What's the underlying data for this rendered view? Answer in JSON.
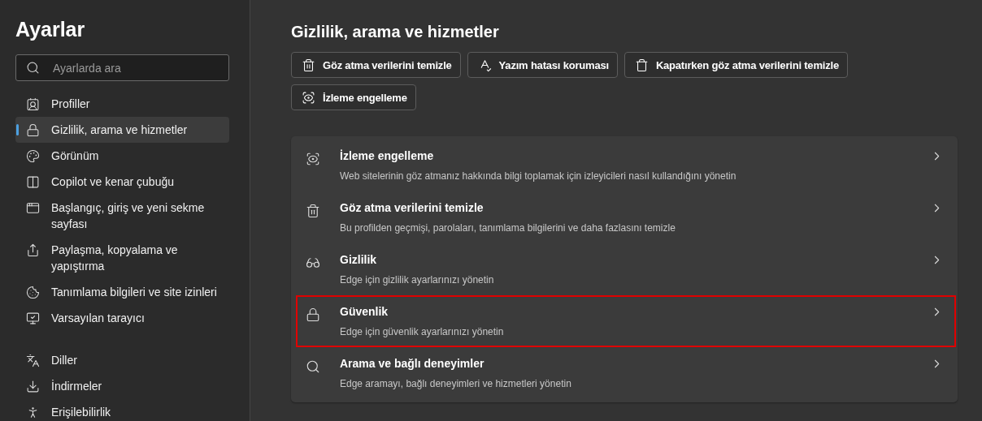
{
  "sidebar": {
    "title": "Ayarlar",
    "search": {
      "placeholder": "Ayarlarda ara"
    },
    "groups": [
      [
        {
          "label": "Profiller",
          "selected": false
        },
        {
          "label": "Gizlilik, arama ve hizmetler",
          "selected": true
        },
        {
          "label": "Görünüm",
          "selected": false
        },
        {
          "label": "Copilot ve kenar çubuğu",
          "selected": false
        },
        {
          "label": "Başlangıç, giriş ve yeni sekme sayfası",
          "selected": false
        },
        {
          "label": "Paylaşma, kopyalama ve yapıştırma",
          "selected": false
        },
        {
          "label": "Tanımlama bilgileri ve site izinleri",
          "selected": false
        },
        {
          "label": "Varsayılan tarayıcı",
          "selected": false
        }
      ],
      [
        {
          "label": "Diller",
          "selected": false
        },
        {
          "label": "İndirmeler",
          "selected": false
        },
        {
          "label": "Erişilebilirlik",
          "selected": false
        }
      ]
    ]
  },
  "main": {
    "title": "Gizlilik, arama ve hizmetler",
    "quick_buttons": [
      "Göz atma verilerini temizle",
      "Yazım hatası koruması",
      "Kapatırken göz atma verilerini temizle",
      "İzleme engelleme"
    ],
    "settings": [
      {
        "title": "İzleme engelleme",
        "description": "Web sitelerinin göz atmanız hakkında bilgi toplamak için izleyicileri nasıl kullandığını yönetin",
        "highlighted": false
      },
      {
        "title": "Göz atma verilerini temizle",
        "description": "Bu profilden geçmişi, parolaları, tanımlama bilgilerini ve daha fazlasını temizle",
        "highlighted": false
      },
      {
        "title": "Gizlilik",
        "description": "Edge için gizlilik ayarlarınızı yönetin",
        "highlighted": false
      },
      {
        "title": "Güvenlik",
        "description": "Edge için güvenlik ayarlarınızı yönetin",
        "highlighted": true
      },
      {
        "title": "Arama ve bağlı deneyimler",
        "description": "Edge aramayı, bağlı deneyimleri ve hizmetleri yönetin",
        "highlighted": false
      }
    ]
  }
}
